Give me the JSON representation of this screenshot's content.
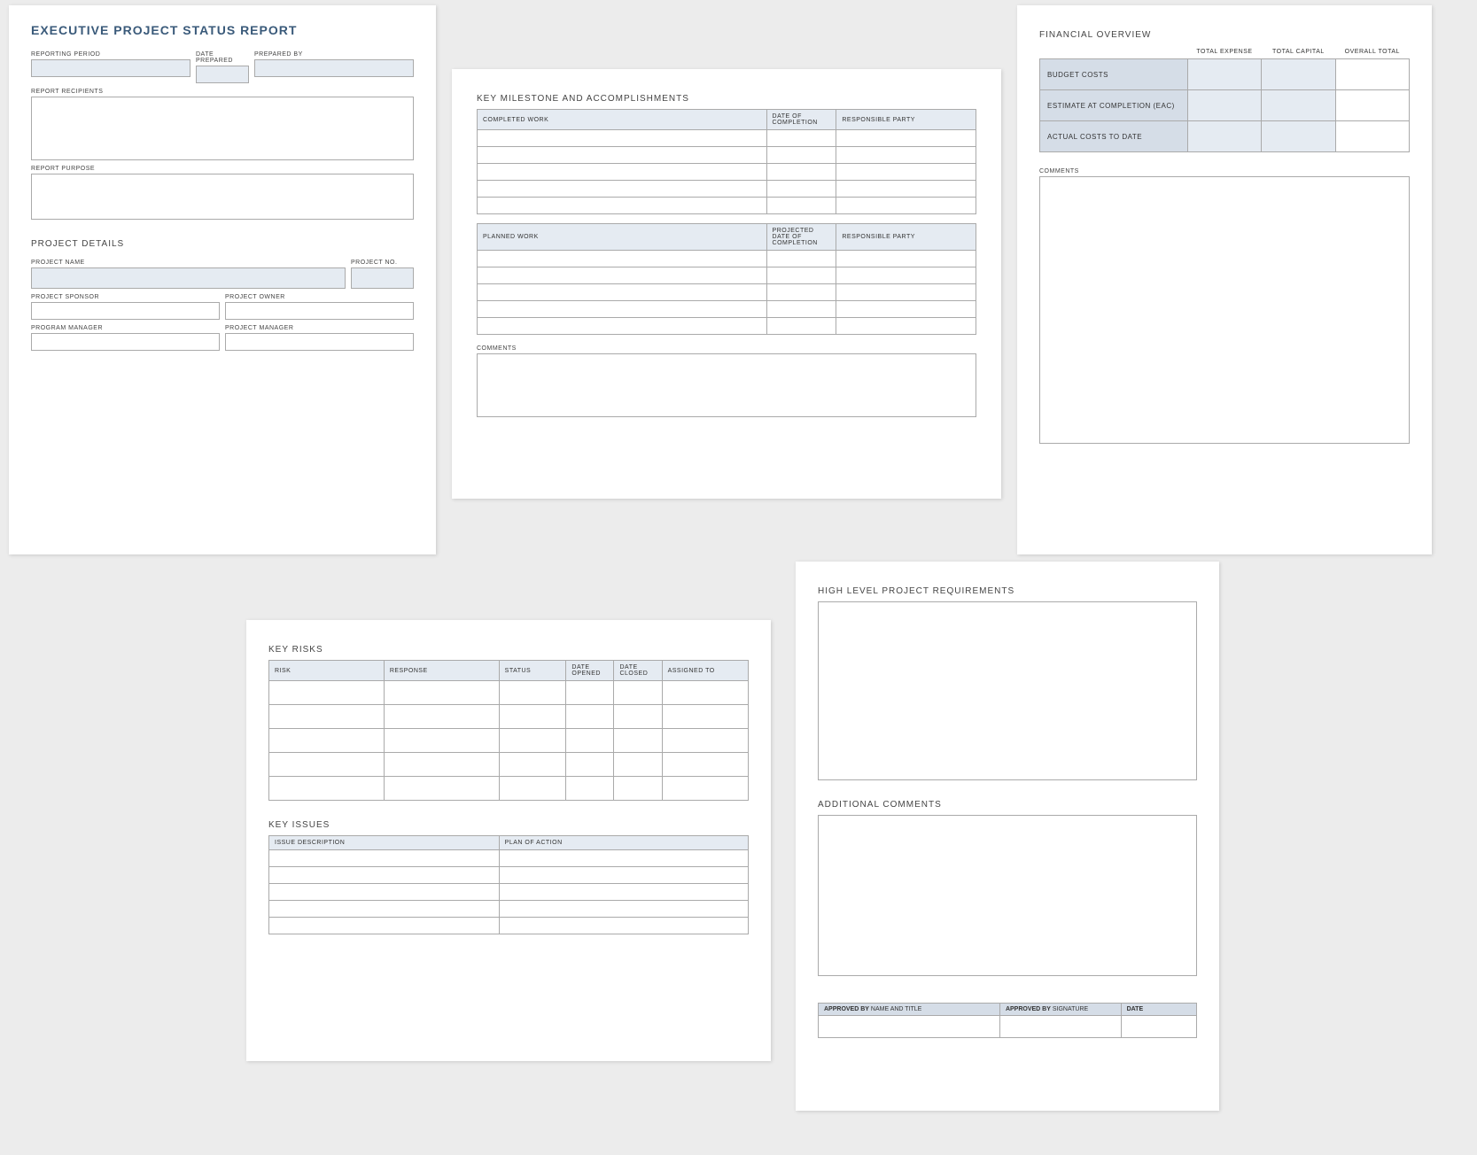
{
  "card1": {
    "title": "EXECUTIVE PROJECT STATUS REPORT",
    "reporting_period": "REPORTING PERIOD",
    "date_prepared": "DATE PREPARED",
    "prepared_by": "PREPARED BY",
    "recipients": "REPORT RECIPIENTS",
    "purpose": "REPORT PURPOSE",
    "project_details": "PROJECT DETAILS",
    "project_name": "PROJECT NAME",
    "project_no": "PROJECT NO.",
    "project_sponsor": "PROJECT SPONSOR",
    "project_owner": "PROJECT OWNER",
    "program_manager": "PROGRAM MANAGER",
    "project_manager": "PROJECT MANAGER"
  },
  "card2": {
    "title": "KEY MILESTONE AND ACCOMPLISHMENTS",
    "completed_work": "COMPLETED WORK",
    "date_completion": "DATE OF COMPLETION",
    "responsible": "RESPONSIBLE PARTY",
    "planned_work": "PLANNED WORK",
    "projected_date": "PROJECTED DATE OF COMPLETION",
    "comments": "COMMENTS"
  },
  "card3": {
    "title": "FINANCIAL OVERVIEW",
    "total_expense": "TOTAL EXPENSE",
    "total_capital": "TOTAL CAPITAL",
    "overall_total": "OVERALL TOTAL",
    "budget_costs": "BUDGET COSTS",
    "eac": "ESTIMATE AT COMPLETION (EAC)",
    "actual": "ACTUAL COSTS TO DATE",
    "comments": "COMMENTS"
  },
  "card4": {
    "key_risks": "KEY RISKS",
    "risk": "RISK",
    "response": "RESPONSE",
    "status": "STATUS",
    "date_opened": "DATE OPENED",
    "date_closed": "DATE CLOSED",
    "assigned_to": "ASSIGNED TO",
    "key_issues": "KEY ISSUES",
    "issue_desc": "ISSUE DESCRIPTION",
    "plan": "PLAN OF ACTION"
  },
  "card5": {
    "hlpr": "HIGH LEVEL PROJECT REQUIREMENTS",
    "additional": "ADDITIONAL COMMENTS",
    "approved_name_label": "APPROVED BY",
    "approved_name_sub": " NAME AND TITLE",
    "approved_sig_label": "APPROVED BY",
    "approved_sig_sub": " SIGNATURE",
    "date": "DATE"
  }
}
